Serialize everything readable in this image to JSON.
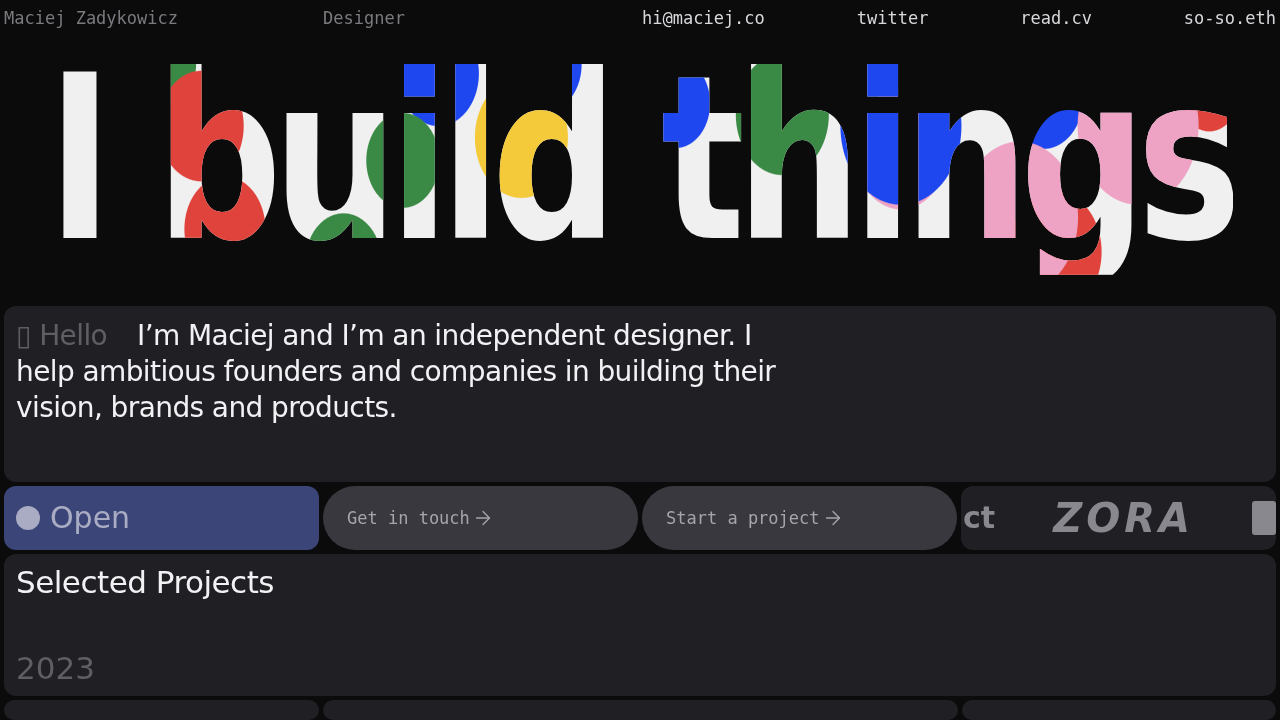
{
  "nav": {
    "name": "Maciej Zadykowicz",
    "role": "Designer",
    "links": [
      "hi@maciej.co",
      "twitter",
      "read.cv",
      "so-so.eth"
    ]
  },
  "hero": {
    "title": "I build things"
  },
  "intro": {
    "glyph": "▯",
    "greeting": "Hello",
    "text": "I’m Maciej and I’m an independent designer. I help ambitious founders and companies in building their vision, brands and products."
  },
  "actions": [
    {
      "kind": "status",
      "label": "Open"
    },
    {
      "kind": "link",
      "label": "Get in touch"
    },
    {
      "kind": "link",
      "label": "Start a project"
    }
  ],
  "marquee": {
    "partial_text": "ct",
    "logo": "ZORA"
  },
  "projects": {
    "title": "Selected Projects",
    "year": "2023"
  }
}
